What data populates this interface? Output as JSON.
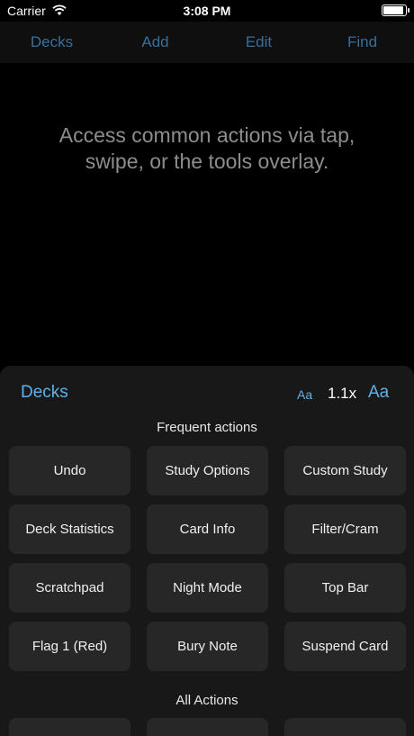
{
  "status_bar": {
    "carrier": "Carrier",
    "time": "3:08 PM"
  },
  "toolbar": {
    "decks": "Decks",
    "add": "Add",
    "edit": "Edit",
    "find": "Find"
  },
  "card": {
    "text": "Access common actions via tap, swipe, or the tools overlay."
  },
  "sheet": {
    "title": "Decks",
    "font_small": "Aa",
    "zoom": "1.1x",
    "font_large": "Aa",
    "frequent_title": "Frequent actions",
    "frequent_actions": [
      "Undo",
      "Study Options",
      "Custom Study",
      "Deck Statistics",
      "Card Info",
      "Filter/Cram",
      "Scratchpad",
      "Night Mode",
      "Top Bar",
      "Flag 1 (Red)",
      "Bury Note",
      "Suspend Card"
    ],
    "all_title": "All Actions"
  },
  "colors": {
    "toolbar_link": "#3a6e97",
    "accent": "#5fb1ea",
    "sheet_bg": "#181818",
    "button_bg": "#272727"
  }
}
